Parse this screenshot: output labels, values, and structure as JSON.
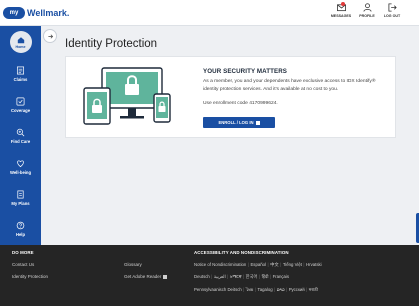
{
  "header": {
    "logo_badge": "my",
    "logo_text": "Wellmark.",
    "messages_label": "MESSAGES",
    "profile_label": "PROFILE",
    "logout_label": "LOG OUT"
  },
  "sidebar": {
    "items": [
      {
        "label": "Home",
        "icon": "home-icon"
      },
      {
        "label": "Claims",
        "icon": "claims-icon"
      },
      {
        "label": "Coverage",
        "icon": "coverage-icon"
      },
      {
        "label": "Find Care",
        "icon": "find-care-icon"
      },
      {
        "label": "Well-being",
        "icon": "well-being-icon"
      },
      {
        "label": "My Plans",
        "icon": "my-plans-icon"
      },
      {
        "label": "Help",
        "icon": "help-icon"
      }
    ]
  },
  "main": {
    "title": "Identity Protection",
    "card": {
      "heading": "YOUR SECURITY MATTERS",
      "body": "As a member, you and your dependents have exclusive access to IDX Identify® identity protection services. And it's available at no cost to you.",
      "code_text": "Use enrollment code 4170999624.",
      "button_label": "ENROLL / LOG IN"
    }
  },
  "footer": {
    "do_more_heading": "DO MORE",
    "contact": "Contact Us",
    "glossary": "Glossary",
    "identity": "Identity Protection",
    "adobe": "Get Adobe Reader",
    "access_heading": "ACCESSIBILITY AND NONDISCRIMINATION",
    "lang_row_1": [
      "Notice of Nondiscrimination",
      "Español",
      "中文",
      "Tiếng Việt",
      "Hrvatski"
    ],
    "lang_row_2": [
      "Deutsch",
      "العربية",
      "አማርኛ",
      "한국어",
      "हिंदी",
      "Français"
    ],
    "lang_row_3": [
      "Pennsylvaanisch Deitsch",
      "ไทย",
      "Tagalog",
      "ລາວ",
      "Русский",
      "मराठी"
    ]
  },
  "colors": {
    "brand_blue": "#1a4fa3",
    "footer_bg": "#252525",
    "illustration_green": "#5fb49c"
  }
}
